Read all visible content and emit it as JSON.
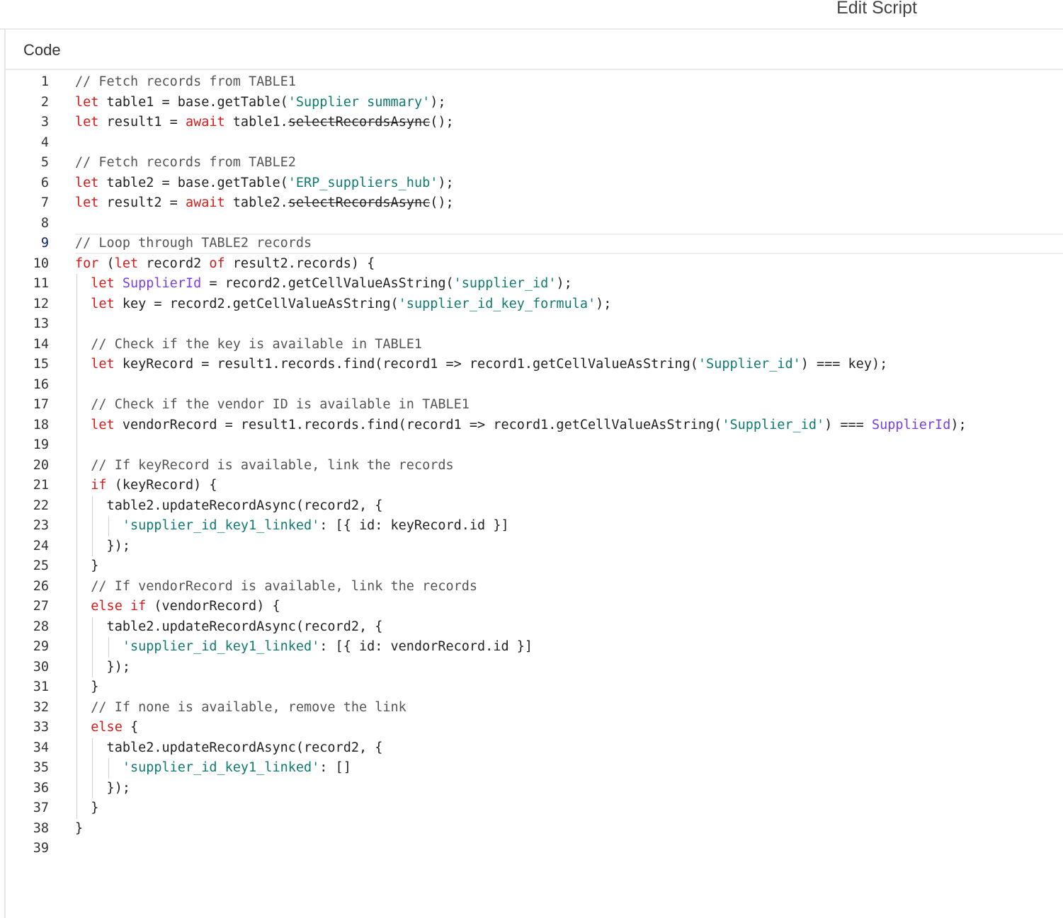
{
  "header": {
    "title": "Edit Script"
  },
  "panel": {
    "label": "Code"
  },
  "editor": {
    "active_line": 9,
    "lines": [
      {
        "n": "1",
        "tokens": [
          {
            "t": "// Fetch records from TABLE1",
            "c": "cm"
          }
        ]
      },
      {
        "n": "2",
        "tokens": [
          {
            "t": "let",
            "c": "kw"
          },
          {
            "t": " table1 = base.getTable(",
            "c": ""
          },
          {
            "t": "'Supplier summary'",
            "c": "str"
          },
          {
            "t": ");",
            "c": ""
          }
        ]
      },
      {
        "n": "3",
        "tokens": [
          {
            "t": "let",
            "c": "kw"
          },
          {
            "t": " result1 = ",
            "c": ""
          },
          {
            "t": "await",
            "c": "kw"
          },
          {
            "t": " table1.",
            "c": ""
          },
          {
            "t": "selectRecordsAsync",
            "c": "strike"
          },
          {
            "t": "();",
            "c": ""
          }
        ]
      },
      {
        "n": "4",
        "tokens": []
      },
      {
        "n": "5",
        "tokens": [
          {
            "t": "// Fetch records from TABLE2",
            "c": "cm"
          }
        ]
      },
      {
        "n": "6",
        "tokens": [
          {
            "t": "let",
            "c": "kw"
          },
          {
            "t": " table2 = base.getTable(",
            "c": ""
          },
          {
            "t": "'ERP_suppliers_hub'",
            "c": "str"
          },
          {
            "t": ");",
            "c": ""
          }
        ]
      },
      {
        "n": "7",
        "tokens": [
          {
            "t": "let",
            "c": "kw"
          },
          {
            "t": " result2 = ",
            "c": ""
          },
          {
            "t": "await",
            "c": "kw"
          },
          {
            "t": " table2.",
            "c": ""
          },
          {
            "t": "selectRecordsAsync",
            "c": "strike"
          },
          {
            "t": "();",
            "c": ""
          }
        ]
      },
      {
        "n": "8",
        "tokens": []
      },
      {
        "n": "9",
        "tokens": [
          {
            "t": "// Loop through TABLE2 records",
            "c": "cm"
          }
        ]
      },
      {
        "n": "10",
        "tokens": [
          {
            "t": "for",
            "c": "kw"
          },
          {
            "t": " (",
            "c": ""
          },
          {
            "t": "let",
            "c": "kw"
          },
          {
            "t": " record2 ",
            "c": ""
          },
          {
            "t": "of",
            "c": "kw"
          },
          {
            "t": " result2.records) {",
            "c": ""
          }
        ]
      },
      {
        "n": "11",
        "tokens": [
          {
            "t": "  ",
            "c": ""
          },
          {
            "t": "let",
            "c": "kw"
          },
          {
            "t": " ",
            "c": ""
          },
          {
            "t": "SupplierId",
            "c": "var"
          },
          {
            "t": " = record2.getCellValueAsString(",
            "c": ""
          },
          {
            "t": "'supplier_id'",
            "c": "str"
          },
          {
            "t": ");",
            "c": ""
          }
        ]
      },
      {
        "n": "12",
        "tokens": [
          {
            "t": "  ",
            "c": ""
          },
          {
            "t": "let",
            "c": "kw"
          },
          {
            "t": " key = record2.getCellValueAsString(",
            "c": ""
          },
          {
            "t": "'supplier_id_key_formula'",
            "c": "str"
          },
          {
            "t": ");",
            "c": ""
          }
        ]
      },
      {
        "n": "13",
        "tokens": []
      },
      {
        "n": "14",
        "tokens": [
          {
            "t": "  ",
            "c": ""
          },
          {
            "t": "// Check if the key is available in TABLE1",
            "c": "cm"
          }
        ]
      },
      {
        "n": "15",
        "tokens": [
          {
            "t": "  ",
            "c": ""
          },
          {
            "t": "let",
            "c": "kw"
          },
          {
            "t": " keyRecord = result1.records.find(record1 => record1.getCellValueAsString(",
            "c": ""
          },
          {
            "t": "'Supplier_id'",
            "c": "str"
          },
          {
            "t": ") === key);",
            "c": ""
          }
        ]
      },
      {
        "n": "16",
        "tokens": []
      },
      {
        "n": "17",
        "tokens": [
          {
            "t": "  ",
            "c": ""
          },
          {
            "t": "// Check if the vendor ID is available in TABLE1",
            "c": "cm"
          }
        ]
      },
      {
        "n": "18",
        "tokens": [
          {
            "t": "  ",
            "c": ""
          },
          {
            "t": "let",
            "c": "kw"
          },
          {
            "t": " vendorRecord = result1.records.find(record1 => record1.getCellValueAsString(",
            "c": ""
          },
          {
            "t": "'Supplier_id'",
            "c": "str"
          },
          {
            "t": ") === ",
            "c": ""
          },
          {
            "t": "SupplierId",
            "c": "var"
          },
          {
            "t": ");",
            "c": ""
          }
        ]
      },
      {
        "n": "19",
        "tokens": []
      },
      {
        "n": "20",
        "tokens": [
          {
            "t": "  ",
            "c": ""
          },
          {
            "t": "// If keyRecord is available, link the records",
            "c": "cm"
          }
        ]
      },
      {
        "n": "21",
        "tokens": [
          {
            "t": "  ",
            "c": ""
          },
          {
            "t": "if",
            "c": "kw"
          },
          {
            "t": " (keyRecord) {",
            "c": ""
          }
        ]
      },
      {
        "n": "22",
        "tokens": [
          {
            "t": "    table2.updateRecordAsync(record2, {",
            "c": ""
          }
        ]
      },
      {
        "n": "23",
        "tokens": [
          {
            "t": "      ",
            "c": ""
          },
          {
            "t": "'supplier_id_key1_linked'",
            "c": "str"
          },
          {
            "t": ": [{ id: keyRecord.id }]",
            "c": ""
          }
        ]
      },
      {
        "n": "24",
        "tokens": [
          {
            "t": "    });",
            "c": ""
          }
        ]
      },
      {
        "n": "25",
        "tokens": [
          {
            "t": "  }",
            "c": ""
          }
        ]
      },
      {
        "n": "26",
        "tokens": [
          {
            "t": "  ",
            "c": ""
          },
          {
            "t": "// If vendorRecord is available, link the records",
            "c": "cm"
          }
        ]
      },
      {
        "n": "27",
        "tokens": [
          {
            "t": "  ",
            "c": ""
          },
          {
            "t": "else",
            "c": "kw"
          },
          {
            "t": " ",
            "c": ""
          },
          {
            "t": "if",
            "c": "kw"
          },
          {
            "t": " (vendorRecord) {",
            "c": ""
          }
        ]
      },
      {
        "n": "28",
        "tokens": [
          {
            "t": "    table2.updateRecordAsync(record2, {",
            "c": ""
          }
        ]
      },
      {
        "n": "29",
        "tokens": [
          {
            "t": "      ",
            "c": ""
          },
          {
            "t": "'supplier_id_key1_linked'",
            "c": "str"
          },
          {
            "t": ": [{ id: vendorRecord.id }]",
            "c": ""
          }
        ]
      },
      {
        "n": "30",
        "tokens": [
          {
            "t": "    });",
            "c": ""
          }
        ]
      },
      {
        "n": "31",
        "tokens": [
          {
            "t": "  }",
            "c": ""
          }
        ]
      },
      {
        "n": "32",
        "tokens": [
          {
            "t": "  ",
            "c": ""
          },
          {
            "t": "// If none is available, remove the link",
            "c": "cm"
          }
        ]
      },
      {
        "n": "33",
        "tokens": [
          {
            "t": "  ",
            "c": ""
          },
          {
            "t": "else",
            "c": "kw"
          },
          {
            "t": " {",
            "c": ""
          }
        ]
      },
      {
        "n": "34",
        "tokens": [
          {
            "t": "    table2.updateRecordAsync(record2, {",
            "c": ""
          }
        ]
      },
      {
        "n": "35",
        "tokens": [
          {
            "t": "      ",
            "c": ""
          },
          {
            "t": "'supplier_id_key1_linked'",
            "c": "str"
          },
          {
            "t": ": []",
            "c": ""
          }
        ]
      },
      {
        "n": "36",
        "tokens": [
          {
            "t": "    });",
            "c": ""
          }
        ]
      },
      {
        "n": "37",
        "tokens": [
          {
            "t": "  }",
            "c": ""
          }
        ]
      },
      {
        "n": "38",
        "tokens": [
          {
            "t": "}",
            "c": ""
          }
        ]
      },
      {
        "n": "39",
        "tokens": []
      }
    ]
  },
  "colors": {
    "keyword": "#d71a1a",
    "string": "#0f7a72",
    "comment": "#555555",
    "variable": "#7a3ee0",
    "active_line_number": "#0b216f"
  }
}
